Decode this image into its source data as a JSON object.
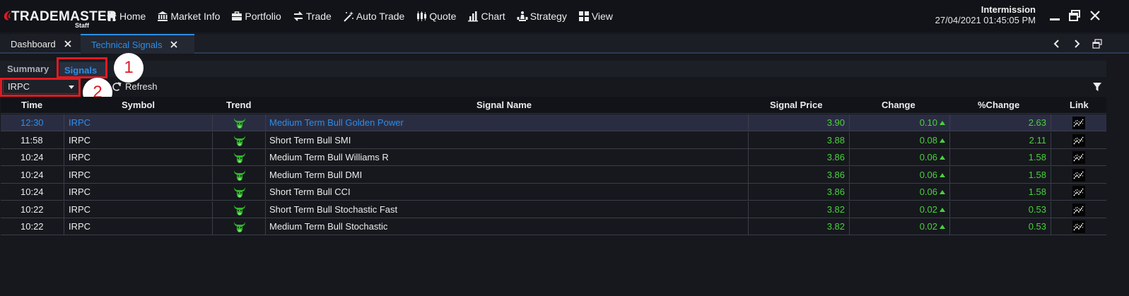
{
  "app": {
    "logo_word_bold": "TRADE",
    "logo_word_rest": "MASTER",
    "logo_sub": "Staff",
    "brand_color": "#e01b22"
  },
  "menu": [
    {
      "label": "Home",
      "icon": "home-icon"
    },
    {
      "label": "Market Info",
      "icon": "bank-icon"
    },
    {
      "label": "Portfolio",
      "icon": "briefcase-icon"
    },
    {
      "label": "Trade",
      "icon": "trade-arrows-icon"
    },
    {
      "label": "Auto Trade",
      "icon": "magic-wand-icon"
    },
    {
      "label": "Quote",
      "icon": "candlestick-icon"
    },
    {
      "label": "Chart",
      "icon": "bar-chart-icon"
    },
    {
      "label": "Strategy",
      "icon": "chess-icon"
    },
    {
      "label": "View",
      "icon": "grid-icon"
    }
  ],
  "status": {
    "session": "Intermission",
    "datetime": "27/04/2021 01:45:05 PM"
  },
  "tabs": [
    {
      "label": "Dashboard",
      "active": false
    },
    {
      "label": "Technical Signals",
      "active": true
    }
  ],
  "subtabs": {
    "summary": "Summary",
    "signals": "Signals"
  },
  "toolbar": {
    "symbol_selected": "IRPC",
    "refresh_label": "Refresh"
  },
  "callouts": [
    "1",
    "2"
  ],
  "table": {
    "headers": {
      "time": "Time",
      "symbol": "Symbol",
      "trend": "Trend",
      "signal_name": "Signal Name",
      "signal_price": "Signal Price",
      "change": "Change",
      "pct_change": "%Change",
      "link": "Link"
    },
    "rows": [
      {
        "time": "12:30",
        "symbol": "IRPC",
        "signal": "Medium Term Bull Golden Power",
        "price": "3.90",
        "change": "0.10",
        "pct": "2.63",
        "selected": true
      },
      {
        "time": "11:58",
        "symbol": "IRPC",
        "signal": "Short Term Bull SMI",
        "price": "3.88",
        "change": "0.08",
        "pct": "2.11",
        "selected": false
      },
      {
        "time": "10:24",
        "symbol": "IRPC",
        "signal": "Medium Term Bull Williams R",
        "price": "3.86",
        "change": "0.06",
        "pct": "1.58",
        "selected": false
      },
      {
        "time": "10:24",
        "symbol": "IRPC",
        "signal": "Medium Term Bull DMI",
        "price": "3.86",
        "change": "0.06",
        "pct": "1.58",
        "selected": false
      },
      {
        "time": "10:24",
        "symbol": "IRPC",
        "signal": "Short Term Bull CCI",
        "price": "3.86",
        "change": "0.06",
        "pct": "1.58",
        "selected": false
      },
      {
        "time": "10:22",
        "symbol": "IRPC",
        "signal": "Short Term Bull Stochastic Fast",
        "price": "3.82",
        "change": "0.02",
        "pct": "0.53",
        "selected": false
      },
      {
        "time": "10:22",
        "symbol": "IRPC",
        "signal": "Medium Term Bull Stochastic",
        "price": "3.82",
        "change": "0.02",
        "pct": "0.53",
        "selected": false
      }
    ]
  },
  "colors": {
    "accent": "#2f8de4",
    "positive": "#49d13c",
    "bull_icon": "#2fb52a",
    "callout": "#e01b22"
  }
}
